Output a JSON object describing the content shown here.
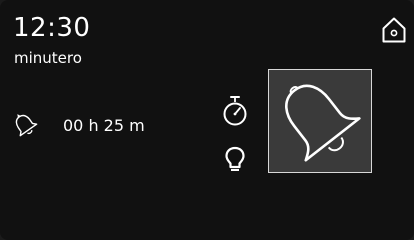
{
  "header": {
    "time": "12:30",
    "subtitle": "minutero"
  },
  "alarm": {
    "duration_text": "00 h 25 m"
  },
  "icons": {
    "home": "home-icon",
    "bell_small": "bell-icon",
    "timer": "stopwatch-icon",
    "bulb": "light-bulb-icon",
    "bell_large": "bell-icon"
  },
  "colors": {
    "background": "#111111",
    "panel": "#3a3a3a",
    "foreground": "#ffffff"
  }
}
